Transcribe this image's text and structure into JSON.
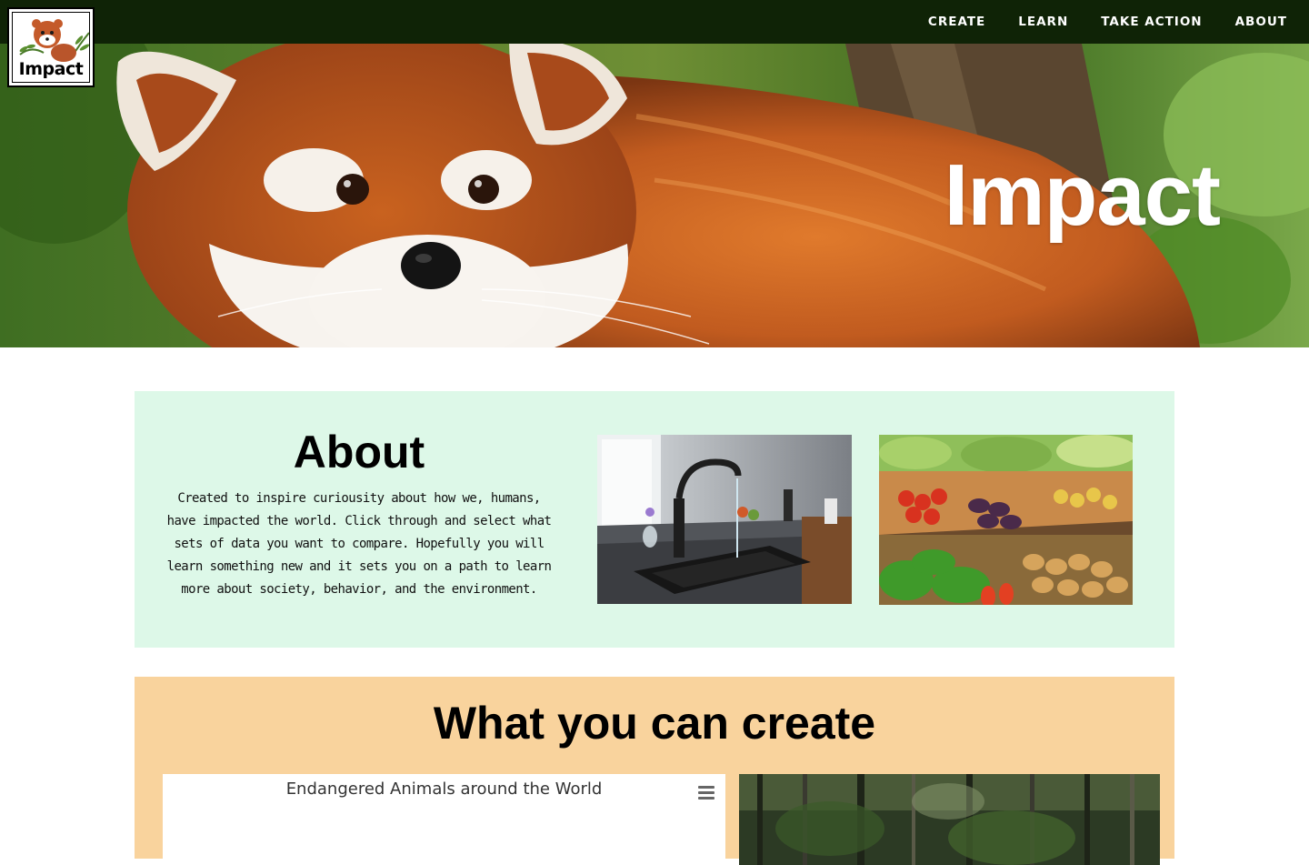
{
  "nav": {
    "items": [
      "CREATE",
      "LEARN",
      "TAKE ACTION",
      "ABOUT"
    ]
  },
  "logo": {
    "text": "Impact"
  },
  "hero": {
    "title": "Impact"
  },
  "about": {
    "title": "About",
    "text": "Created to inspire curiousity about how we, humans, have impacted the world. Click through and select what sets of data you want to compare. Hopefully you will learn something new and it sets you on a path to learn more about society, behavior, and the environment."
  },
  "create": {
    "title": "What you can create",
    "chart_title": "Endangered Animals around the World"
  },
  "colors": {
    "nav_bg": "#0f2306",
    "about_bg": "#ddf8e8",
    "create_bg": "#f9d39d"
  }
}
